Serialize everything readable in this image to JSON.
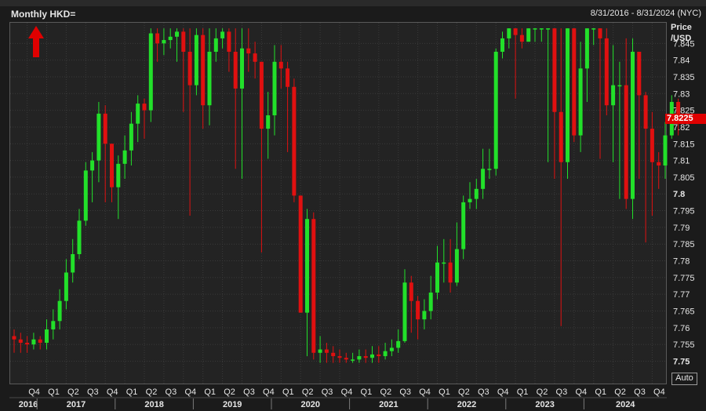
{
  "header": {
    "title": "Monthly HKD=",
    "date_range": "8/31/2016 - 8/31/2024 (NYC)"
  },
  "colors": {
    "up": "#22e02a",
    "down": "#e01010",
    "grid": "#3a3a3a",
    "text": "#e6e6e6",
    "arrow": "#e00000"
  },
  "axis": {
    "price_label_line1": "Price",
    "price_label_line2": "/USD",
    "auto_label": "Auto"
  },
  "last_price": "7.8225",
  "chart_data": {
    "type": "candlestick",
    "title": "Monthly HKD=",
    "ylabel": "Price /USD",
    "ylim": [
      7.748,
      7.85
    ],
    "y_ticks": [
      7.75,
      7.755,
      7.76,
      7.765,
      7.77,
      7.775,
      7.78,
      7.785,
      7.79,
      7.795,
      7.8,
      7.805,
      7.81,
      7.815,
      7.82,
      7.825,
      7.83,
      7.835,
      7.84,
      7.845
    ],
    "y_tick_labels": [
      "7.75",
      "7.755",
      "7.76",
      "7.765",
      "7.77",
      "7.775",
      "7.78",
      "7.785",
      "7.79",
      "7.795",
      "7.8",
      "7.805",
      "7.81",
      "7.815",
      "7.82",
      "7.825",
      "7.83",
      "7.835",
      "7.84",
      "7.845"
    ],
    "quarter_labels": [
      "Q4",
      "Q1",
      "Q2",
      "Q3",
      "Q4",
      "Q1",
      "Q2",
      "Q3",
      "Q4",
      "Q1",
      "Q2",
      "Q3",
      "Q4",
      "Q1",
      "Q2",
      "Q3",
      "Q4",
      "Q1",
      "Q2",
      "Q3",
      "Q4",
      "Q1",
      "Q2",
      "Q3",
      "Q4",
      "Q1",
      "Q2",
      "Q3",
      "Q4",
      "Q1",
      "Q2",
      "Q3",
      "Q4",
      "Q1",
      "Q2",
      "Q3"
    ],
    "year_labels": [
      "2016",
      "2017",
      "2018",
      "2019",
      "2020",
      "2021",
      "2022",
      "2023",
      "2024"
    ],
    "closes": [
      7.7565,
      7.7555,
      7.755,
      7.7565,
      7.7555,
      7.7595,
      7.762,
      7.768,
      7.7765,
      7.782,
      7.792,
      7.807,
      7.81,
      7.824,
      7.815,
      7.802,
      7.809,
      7.813,
      7.821,
      7.827,
      7.825,
      7.848,
      7.845,
      7.846,
      7.847,
      7.8485,
      7.8425,
      7.8325,
      7.8475,
      7.8265,
      7.8425,
      7.8465,
      7.8485,
      7.8425,
      7.8315,
      7.8435,
      7.842,
      7.8395,
      7.8195,
      7.8235,
      7.8395,
      7.8375,
      7.832,
      7.7995,
      7.7645,
      7.7925,
      7.7525,
      7.7535,
      7.7525,
      7.7515,
      7.751,
      7.7505,
      7.7505,
      7.7515,
      7.751,
      7.752,
      7.7515,
      7.753,
      7.754,
      7.756,
      7.7735,
      7.768,
      7.7625,
      7.765,
      7.7705,
      7.7795,
      7.7795,
      7.7735,
      7.7835,
      7.7975,
      7.7985,
      7.8015,
      7.8075,
      7.8075,
      7.8425,
      7.8465,
      7.8495,
      7.8475,
      7.8455,
      7.8495,
      7.8495,
      7.8495,
      7.8495,
      7.8245,
      7.8095,
      7.8495,
      7.8175,
      7.8375,
      7.8495,
      7.8495,
      7.8465,
      7.8265,
      7.8325,
      7.8325,
      7.7985,
      7.8425,
      7.8295,
      7.8195,
      7.8095,
      7.8085,
      7.8175,
      7.8275,
      7.8225
    ],
    "highs": [
      7.7595,
      7.7585,
      7.7575,
      7.7585,
      7.7575,
      7.7625,
      7.7655,
      7.7715,
      7.7805,
      7.7865,
      7.7955,
      7.8095,
      7.8125,
      7.8275,
      7.8265,
      7.8095,
      7.8115,
      7.8175,
      7.8245,
      7.8295,
      7.8285,
      7.8495,
      7.8495,
      7.8495,
      7.8495,
      7.8495,
      7.8495,
      7.8495,
      7.8495,
      7.8495,
      7.8495,
      7.8495,
      7.8495,
      7.8495,
      7.8495,
      7.8495,
      7.8495,
      7.8455,
      7.8355,
      7.8305,
      7.8445,
      7.8445,
      7.8395,
      7.8345,
      7.7995,
      7.7955,
      7.7945,
      7.7575,
      7.7555,
      7.7545,
      7.7535,
      7.7525,
      7.7525,
      7.7535,
      7.7535,
      7.7545,
      7.7545,
      7.7555,
      7.7565,
      7.7595,
      7.7775,
      7.7755,
      7.7695,
      7.7685,
      7.7755,
      7.7845,
      7.7865,
      7.7865,
      7.7915,
      7.7995,
      7.8035,
      7.8045,
      7.8135,
      7.8135,
      7.8435,
      7.8485,
      7.8495,
      7.8495,
      7.8495,
      7.8495,
      7.8495,
      7.8495,
      7.8495,
      7.8495,
      7.8495,
      7.8495,
      7.8495,
      7.8455,
      7.8495,
      7.8495,
      7.8495,
      7.8495,
      7.8445,
      7.8395,
      7.8465,
      7.8465,
      7.8385,
      7.8305,
      7.8245,
      7.8125,
      7.8215,
      7.8295,
      7.8285
    ],
    "lows": [
      7.7525,
      7.7525,
      7.7525,
      7.7535,
      7.7535,
      7.7535,
      7.7565,
      7.7595,
      7.7655,
      7.7735,
      7.7805,
      7.7905,
      7.7975,
      7.8035,
      7.7975,
      7.7975,
      7.7925,
      7.8045,
      7.8085,
      7.8155,
      7.8165,
      7.8215,
      7.8395,
      7.8415,
      7.8435,
      7.8395,
      7.8245,
      7.7935,
      7.8295,
      7.8195,
      7.8205,
      7.8395,
      7.8435,
      7.8365,
      7.8075,
      7.8045,
      7.8365,
      7.8345,
      7.7825,
      7.8105,
      7.8175,
      7.8315,
      7.8125,
      7.7975,
      7.7645,
      7.7515,
      7.7505,
      7.7495,
      7.7495,
      7.7495,
      7.7495,
      7.7495,
      7.7495,
      7.7495,
      7.7495,
      7.7495,
      7.7495,
      7.7505,
      7.7515,
      7.7525,
      7.7555,
      7.7585,
      7.7565,
      7.7595,
      7.7625,
      7.7685,
      7.7735,
      7.7705,
      7.7725,
      7.7805,
      7.7955,
      7.7955,
      7.7985,
      7.8045,
      7.8055,
      7.8405,
      7.8435,
      7.8285,
      7.8435,
      7.8455,
      7.8455,
      7.8455,
      7.8095,
      7.8045,
      7.7605,
      7.8045,
      7.8155,
      7.8125,
      7.8275,
      7.8445,
      7.8105,
      7.8235,
      7.8095,
      7.7985,
      7.7955,
      7.7925,
      7.8045,
      7.7855,
      7.7935,
      7.8015,
      7.8045,
      7.8165,
      7.8175
    ]
  }
}
